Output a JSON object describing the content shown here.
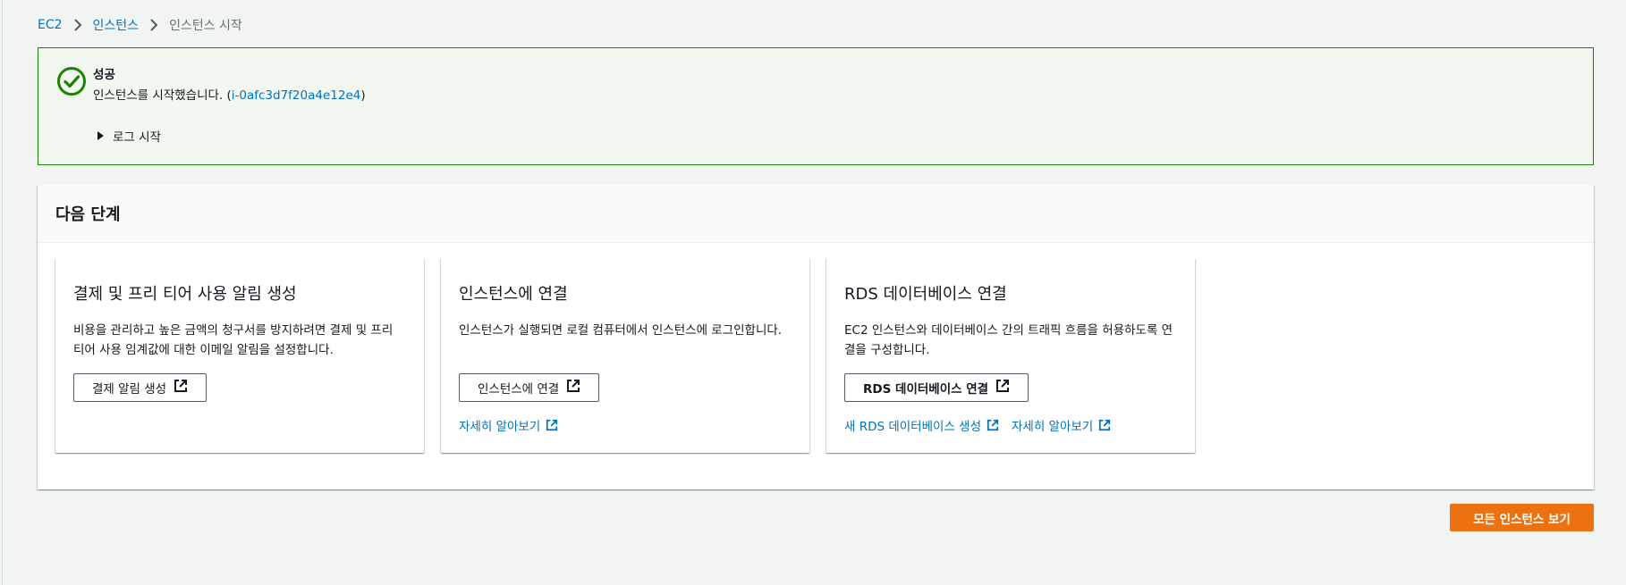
{
  "breadcrumb": {
    "items": [
      "EC2",
      "인스턴스",
      "인스턴스 시작"
    ]
  },
  "flash": {
    "title": "성공",
    "message_prefix": "인스턴스를 시작했습니다. (",
    "instance_id": "i-0afc3d7f20a4e12e4",
    "message_suffix": ")",
    "expander_label": "로그 시작",
    "color": "#1d8102"
  },
  "next_steps": {
    "title": "다음 단계",
    "cards": [
      {
        "title": "결제 및 프리 티어 사용 알림 생성",
        "description": "비용을 관리하고 높은 금액의 청구서를 방지하려면 결제 및 프리 티어 사용 임계값에 대한 이메일 알림을 설정합니다.",
        "button_label": "결제 알림 생성"
      },
      {
        "title": "인스턴스에 연결",
        "description": "인스턴스가 실행되면 로컬 컴퓨터에서 인스턴스에 로그인합니다.",
        "button_label": "인스턴스에 연결",
        "links": [
          "자세히 알아보기"
        ]
      },
      {
        "title": "RDS 데이터베이스 연결",
        "description": "EC2 인스턴스와 데이터베이스 간의 트래픽 흐름을 허용하도록 연결을 구성합니다.",
        "button_label": "RDS 데이터베이스 연결",
        "links": [
          "새 RDS 데이터베이스 생성",
          "자세히 알아보기"
        ]
      }
    ]
  },
  "primary_button": {
    "label": "모든 인스턴스 보기",
    "color": "#ec7211"
  },
  "icons": {
    "breadcrumb_separator": "chevron-right-icon",
    "flash": "check-circle-icon",
    "expander": "caret-right-icon",
    "external": "external-link-icon"
  }
}
